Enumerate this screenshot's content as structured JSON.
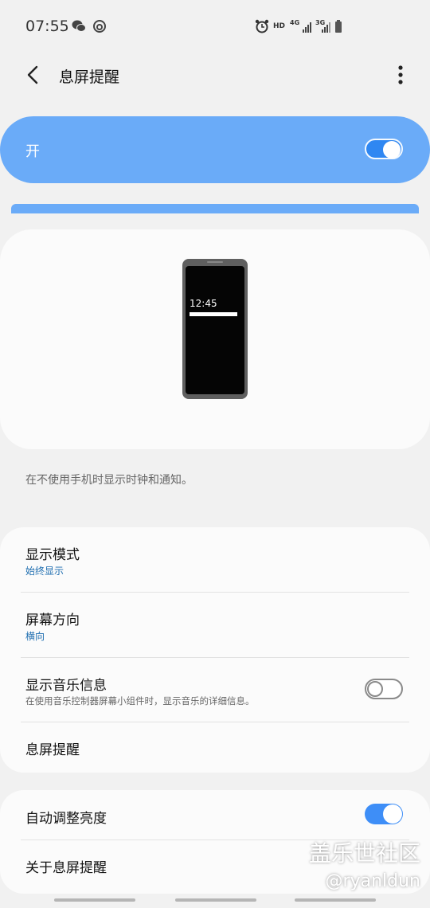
{
  "status_bar": {
    "time": "07:55",
    "icons": [
      "wechat-icon",
      "netease-music-icon",
      "alarm-icon",
      "hd-icon",
      "4g-signal-icon",
      "3g-signal-icon",
      "battery-icon"
    ],
    "hd_label": "HD",
    "net1": "4G",
    "net2": "3G"
  },
  "header": {
    "title": "息屏提醒",
    "back_icon": "back-arrow-icon",
    "more_icon": "more-vertical-icon"
  },
  "master_switch": {
    "label": "开",
    "on": true
  },
  "preview": {
    "clock": "12:45"
  },
  "description": "在不使用手机时显示时钟和通知。",
  "settings_card": {
    "items": [
      {
        "title": "显示模式",
        "subtitle": "始终显示"
      },
      {
        "title": "屏幕方向",
        "subtitle": "横向"
      },
      {
        "title": "显示音乐信息",
        "description": "在使用音乐控制器屏幕小组件时，显示音乐的详细信息。",
        "toggle": false
      },
      {
        "title": "息屏提醒"
      }
    ]
  },
  "settings_card2": {
    "items": [
      {
        "title": "自动调整亮度",
        "toggle": true
      },
      {
        "title": "关于息屏提醒"
      }
    ]
  },
  "watermark": {
    "line1": "盖乐世社区",
    "line2": "@ryanldun"
  },
  "colors": {
    "accent": "#6aabf8",
    "toggle_on": "#3e8ef7",
    "link": "#1f6eb0",
    "background": "#f1f1f1"
  }
}
